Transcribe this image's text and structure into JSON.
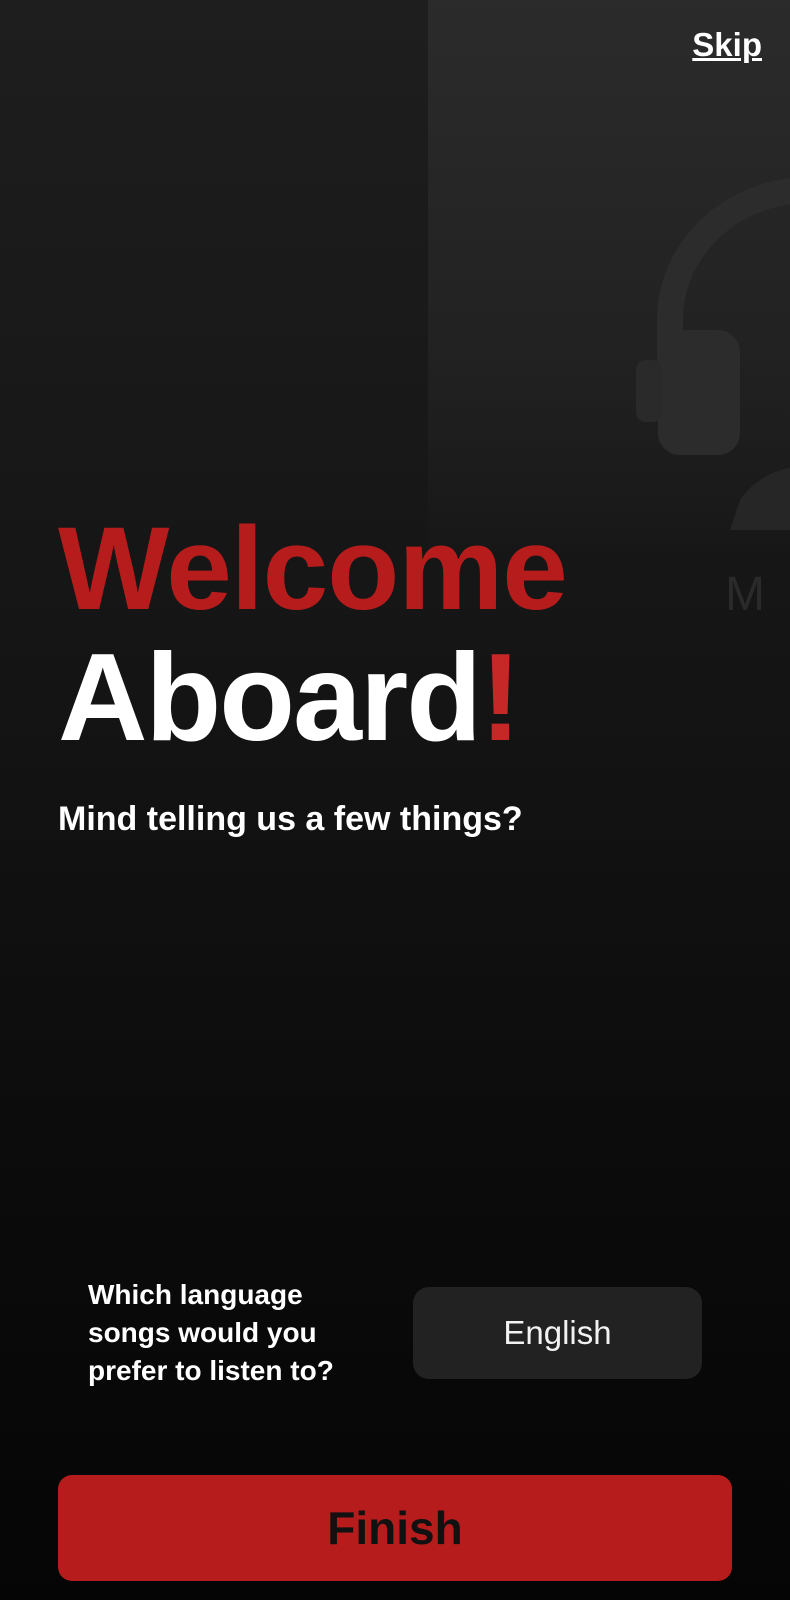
{
  "header": {
    "skip_label": "Skip"
  },
  "welcome": {
    "line1": "Welcome",
    "line2": "Aboard",
    "exclaim": "!",
    "subtitle": "Mind telling us a few things?"
  },
  "language": {
    "question": "Which language songs would you prefer to listen to?",
    "selected": "English"
  },
  "footer": {
    "finish_label": "Finish"
  },
  "colors": {
    "accent": "#b71c1c",
    "background": "#0b0b0b",
    "selector": "#222222"
  },
  "icons": {
    "background_art": "headphones-icon"
  }
}
